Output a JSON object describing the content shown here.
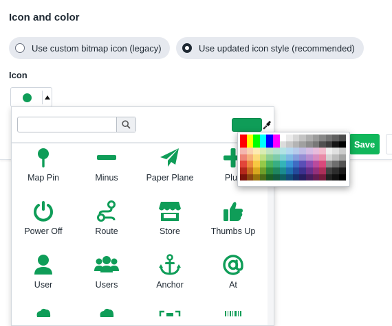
{
  "section_title": "Icon and color",
  "radio_options": [
    {
      "label": "Use custom bitmap icon (legacy)",
      "selected": false
    },
    {
      "label": "Use updated icon style (recommended)",
      "selected": true
    }
  ],
  "icon_field_label": "Icon",
  "selected_color": "#0f9d58",
  "save_label": "Save",
  "search": {
    "value": "",
    "placeholder": ""
  },
  "icons": [
    {
      "label": "Map Pin",
      "icon": "map-pin-icon"
    },
    {
      "label": "Minus",
      "icon": "minus-icon"
    },
    {
      "label": "Paper Plane",
      "icon": "paper-plane-icon"
    },
    {
      "label": "Plus",
      "icon": "plus-icon"
    },
    {
      "label": "Power Off",
      "icon": "power-off-icon"
    },
    {
      "label": "Route",
      "icon": "route-icon"
    },
    {
      "label": "Store",
      "icon": "store-icon"
    },
    {
      "label": "Thumbs Up",
      "icon": "thumbs-up-icon"
    },
    {
      "label": "User",
      "icon": "user-icon"
    },
    {
      "label": "Users",
      "icon": "users-icon"
    },
    {
      "label": "Anchor",
      "icon": "anchor-icon"
    },
    {
      "label": "At",
      "icon": "at-icon"
    }
  ],
  "palette_rows": [
    [
      "#ff0000",
      "#ffff00",
      "#00ff00",
      "#00ffff",
      "#0000ff",
      "#ff00ff",
      "#ffffff",
      "#ebebeb",
      "#d7d7d7",
      "#c3c3c3",
      "#afafaf",
      "#9b9b9b",
      "#878787",
      "#737373",
      "#5f5f5f",
      "#4b4b4b"
    ],
    [
      "#ff0000",
      "#ffff00",
      "#00ff00",
      "#00ffff",
      "#0000ff",
      "#ff00ff",
      "#dcdcdc",
      "#c8c8c8",
      "#b4b4b4",
      "#a0a0a0",
      "#8c8c8c",
      "#787878",
      "#505050",
      "#3c3c3c",
      "#141414",
      "#000000"
    ],
    [
      "#f4b6b0",
      "#f9d2b0",
      "#fdeab2",
      "#d9ecb3",
      "#bfe3c0",
      "#b3e1cf",
      "#b2e3e4",
      "#b3d8f0",
      "#b7cbeb",
      "#c1bde6",
      "#d6bde4",
      "#e8bcdc",
      "#f2bccd",
      "#eeeeee",
      "#e0e0e0",
      "#cccccc"
    ],
    [
      "#ee8577",
      "#f5b07a",
      "#fbdb7c",
      "#bfdf81",
      "#8ecf93",
      "#7ecbab",
      "#7ccfd2",
      "#7eb9e4",
      "#859fdc",
      "#968dd3",
      "#b88ed0",
      "#d68dc1",
      "#e88ba7",
      "#d4d4d4",
      "#bcbcbc",
      "#a4a4a4"
    ],
    [
      "#e2463a",
      "#ec8a3e",
      "#f7c842",
      "#95c949",
      "#4bb35e",
      "#38ae83",
      "#34b4b8",
      "#3a95d5",
      "#3f6cc3",
      "#5a4fb6",
      "#8b4cb1",
      "#b94a9d",
      "#d8497b",
      "#8a8a8a",
      "#6e6e6e",
      "#545454"
    ],
    [
      "#b4281c",
      "#c66a20",
      "#d9a81f",
      "#6f9f2a",
      "#2e8b3c",
      "#1f865f",
      "#1b8c90",
      "#1f6fae",
      "#244a9b",
      "#3c318e",
      "#68308b",
      "#93307b",
      "#ad2f59",
      "#404040",
      "#2c2c2c",
      "#1a1a1a"
    ],
    [
      "#7a140b",
      "#8a4510",
      "#97720c",
      "#4b6c18",
      "#1a5f25",
      "#115b40",
      "#0e5f62",
      "#114b78",
      "#152f6a",
      "#261e60",
      "#461d5e",
      "#651c53",
      "#761b3b",
      "#222222",
      "#111111",
      "#000000"
    ]
  ]
}
